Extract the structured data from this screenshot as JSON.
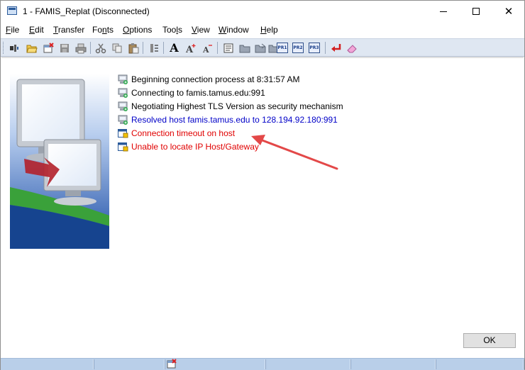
{
  "window": {
    "title": "1 - FAMIS_Replat (Disconnected)"
  },
  "title_buttons": {
    "minimize": "minimize",
    "maximize": "maximize",
    "close": "close"
  },
  "menu": [
    {
      "label": "File",
      "u": "F",
      "rest": "ile"
    },
    {
      "label": "Edit",
      "u": "E",
      "rest": "dit"
    },
    {
      "label": "Transfer",
      "u": "T",
      "rest": "ransfer"
    },
    {
      "label": "Fonts",
      "pre": "Fo",
      "u": "n",
      "rest": "ts"
    },
    {
      "label": "Options",
      "u": "O",
      "rest": "ptions"
    },
    {
      "label": "Tools",
      "pre": "Too",
      "u": "l",
      "rest": "s"
    },
    {
      "label": "View",
      "u": "V",
      "rest": "iew"
    },
    {
      "label": "Window",
      "u": "W",
      "rest": "indow"
    },
    {
      "label": "Help",
      "u": "H",
      "rest": "elp"
    }
  ],
  "toolbar": {
    "icons": [
      "connect-icon",
      "open-icon",
      "disconnect-icon",
      "save-icon",
      "print-icon",
      "cut-icon",
      "copy-icon",
      "paste-icon",
      "transfer-icon",
      "font-icon",
      "font-larger-icon",
      "font-smaller-icon",
      "keyboard-map-icon",
      "folder-icon",
      "folder-open-icon",
      "folder-send-icon"
    ],
    "pr_buttons": [
      "PR1",
      "PR2",
      "PR3"
    ],
    "font_glyph": "A",
    "enter_icon": "enter-icon",
    "eraser_icon": "eraser-icon"
  },
  "log": [
    {
      "text": "Beginning connection process at 8:31:57 AM",
      "kind": "info",
      "color": "#000000",
      "icon": "network-computer-icon"
    },
    {
      "text": "Connecting to famis.tamus.edu:991",
      "kind": "info",
      "color": "#000000",
      "icon": "network-computer-icon"
    },
    {
      "text": "Negotiating Highest TLS Version as security mechanism",
      "kind": "info",
      "color": "#000000",
      "icon": "network-computer-icon"
    },
    {
      "text": "Resolved host famis.tamus.edu to 128.194.92.180:991",
      "kind": "resolved",
      "color": "#0000c8",
      "icon": "network-computer-icon"
    },
    {
      "text": "Connection timeout on host",
      "kind": "error",
      "color": "#e00000",
      "icon": "error-window-icon"
    },
    {
      "text": "Unable to locate IP Host/Gateway",
      "kind": "error",
      "color": "#e00000",
      "icon": "error-window-icon"
    }
  ],
  "dialog": {
    "ok_label": "OK"
  },
  "annotation": {
    "arrow_color": "#e34848",
    "points_to": "Connection timeout on host"
  },
  "colors": {
    "toolbar_bg": "#dfe7f2",
    "statusbar_bg": "#b9cfe9",
    "image_blue": "#1a4ca6",
    "image_green": "#3aa13a"
  }
}
